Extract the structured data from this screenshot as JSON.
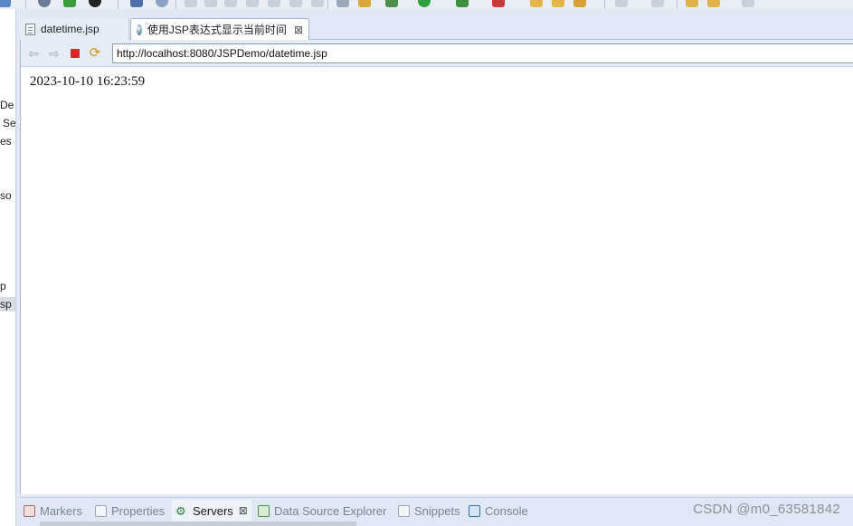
{
  "window": {
    "editor_tabs": [
      {
        "label": "datetime.jsp",
        "active": false
      },
      {
        "label": "使用JSP表达式显示当前时间",
        "active": true
      }
    ]
  },
  "left_panel": {
    "rows": [
      "De",
      "Se",
      "es",
      "so",
      "p",
      "sp"
    ]
  },
  "browser": {
    "url": "http://localhost:8080/JSPDemo/datetime.jsp",
    "content_text": "2023-10-10 16:23:59"
  },
  "bottom_tabs": [
    {
      "label": "Markers",
      "active": false
    },
    {
      "label": "Properties",
      "active": false
    },
    {
      "label": "Servers",
      "active": true
    },
    {
      "label": "Data Source Explorer",
      "active": false
    },
    {
      "label": "Snippets",
      "active": false
    },
    {
      "label": "Console",
      "active": false
    }
  ],
  "watermark": "CSDN @m0_63581842",
  "colors": {
    "stop_red": "#d8262b",
    "refresh_orange": "#d49a18",
    "chrome_blue": "#dfe8f4"
  }
}
